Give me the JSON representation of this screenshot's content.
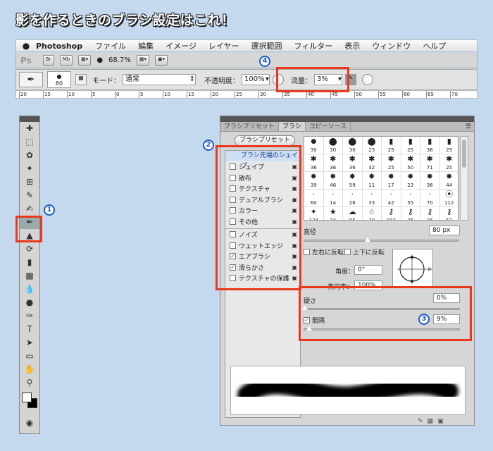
{
  "headline": "影を作るときのブラシ設定はこれ！",
  "menubar": {
    "app_name": "Photoshop",
    "items": [
      "ファイル",
      "編集",
      "イメージ",
      "レイヤー",
      "選択範囲",
      "フィルター",
      "表示",
      "ウィンドウ",
      "ヘルプ"
    ]
  },
  "appbar": {
    "logo": "Ps",
    "bridge": "Br",
    "minibridge": "Mb",
    "zoom": "68.7%"
  },
  "options": {
    "brush_size": "80",
    "mode_label": "モード：",
    "mode_value": "通常",
    "opacity_label": "不透明度：",
    "opacity_value": "100%",
    "flow_label": "流量：",
    "flow_value": "3%"
  },
  "ruler": [
    "20",
    "15",
    "10",
    "5",
    "0",
    "5",
    "10",
    "15",
    "20",
    "25",
    "30",
    "35",
    "40",
    "45",
    "50",
    "55",
    "60",
    "65",
    "70"
  ],
  "brush_panel": {
    "tabs": [
      "ブラシプリセット",
      "ブラシ",
      "コピーソース"
    ],
    "active_tab": 1,
    "preset_button": "ブラシプリセット",
    "list_header": "ブラシ先端のシェイプ",
    "list": [
      {
        "label": "シェイプ",
        "checked": false
      },
      {
        "label": "散布",
        "checked": false
      },
      {
        "label": "テクスチャ",
        "checked": false
      },
      {
        "label": "デュアルブラシ",
        "checked": false
      },
      {
        "label": "カラー",
        "checked": false
      },
      {
        "label": "その他",
        "checked": false
      },
      {
        "label": "ノイズ",
        "checked": false
      },
      {
        "label": "ウェットエッジ",
        "checked": false
      },
      {
        "label": "エアブラシ",
        "checked": true
      },
      {
        "label": "滑らかさ",
        "checked": true
      },
      {
        "label": "テクスチャの保護",
        "checked": false
      }
    ],
    "brush_sizes": [
      "30",
      "30",
      "30",
      "25",
      "25",
      "25",
      "36",
      "25",
      "36",
      "36",
      "36",
      "32",
      "25",
      "50",
      "71",
      "25",
      "39",
      "46",
      "59",
      "11",
      "17",
      "23",
      "36",
      "44",
      "60",
      "14",
      "26",
      "33",
      "42",
      "55",
      "70",
      "112",
      "134",
      "74",
      "95",
      "29",
      "192",
      "36",
      "36",
      "63"
    ],
    "diameter_label": "直径",
    "diameter_value": "80 px",
    "flip_x": "左右に反転",
    "flip_y": "上下に反転",
    "angle_label": "角度：",
    "angle_value": "0°",
    "roundness_label": "真円率：",
    "roundness_value": "100%",
    "hardness_label": "硬さ",
    "hardness_value": "0%",
    "spacing_label": "間隔",
    "spacing_value": "9%"
  },
  "callouts": [
    "1",
    "2",
    "3",
    "4"
  ],
  "colors": {
    "accent_red": "#e8391c",
    "callout_blue": "#1f5bbf",
    "background": "#c5d9ee"
  }
}
